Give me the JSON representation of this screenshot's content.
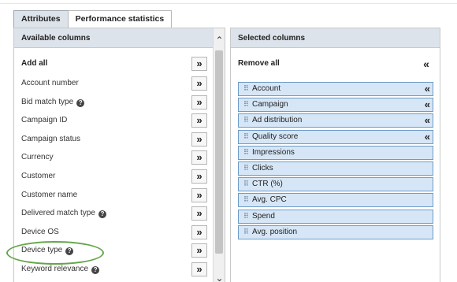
{
  "tabs": [
    {
      "label": "Attributes",
      "active": true
    },
    {
      "label": "Performance statistics",
      "active": false
    }
  ],
  "available": {
    "header": "Available columns",
    "add_all_label": "Add all",
    "add_glyph": "»",
    "items": [
      {
        "label": "Account number",
        "help": false
      },
      {
        "label": "Bid match type",
        "help": true
      },
      {
        "label": "Campaign ID",
        "help": false
      },
      {
        "label": "Campaign status",
        "help": false
      },
      {
        "label": "Currency",
        "help": false
      },
      {
        "label": "Customer",
        "help": false
      },
      {
        "label": "Customer name",
        "help": false
      },
      {
        "label": "Delivered match type",
        "help": true
      },
      {
        "label": "Device OS",
        "help": false
      },
      {
        "label": "Device type",
        "help": true
      },
      {
        "label": "Keyword relevance",
        "help": true
      }
    ]
  },
  "selected": {
    "header": "Selected columns",
    "remove_all_label": "Remove all",
    "remove_glyph": "«",
    "items": [
      {
        "label": "Account",
        "removable": true
      },
      {
        "label": "Campaign",
        "removable": true
      },
      {
        "label": "Ad distribution",
        "removable": true
      },
      {
        "label": "Quality score",
        "removable": true
      },
      {
        "label": "Impressions",
        "removable": false
      },
      {
        "label": "Clicks",
        "removable": false
      },
      {
        "label": "CTR (%)",
        "removable": false
      },
      {
        "label": "Avg. CPC",
        "removable": false
      },
      {
        "label": "Spend",
        "removable": false
      },
      {
        "label": "Avg. position",
        "removable": false
      }
    ]
  },
  "icons": {
    "help": "question-circle-icon",
    "grip": "drag-handle-icon",
    "scroll_up": "chevron-up-icon",
    "scroll_down": "chevron-down-icon"
  },
  "highlight_target": "Device type",
  "colors": {
    "tab_active_bg": "#dde3ea",
    "header_bg": "#dde3ea",
    "selected_item_bg": "#d6e6f6",
    "selected_item_border": "#6d9bc7",
    "highlight": "#63a64a"
  }
}
